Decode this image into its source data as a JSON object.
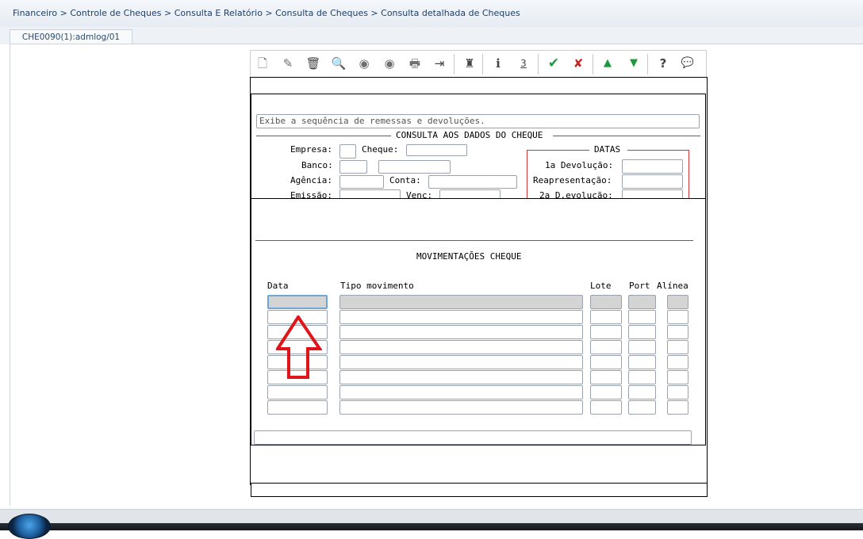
{
  "breadcrumb": {
    "path": "Financeiro > Controle de Cheques > Consulta E Relatório > Consulta de Cheques > Consulta detalhada de Cheques"
  },
  "tab": {
    "label": "CHE0090(1):admlog/01"
  },
  "toolbar": {
    "buttons": [
      {
        "icon": "new-doc-icon",
        "glyph": "🗋"
      },
      {
        "icon": "edit-icon",
        "glyph": "✎"
      },
      {
        "icon": "trash-icon",
        "glyph": "🗑"
      },
      {
        "icon": "magnifier-icon",
        "glyph": "🔍"
      },
      {
        "icon": "prev-circle-icon",
        "glyph": "◉"
      },
      {
        "icon": "next-circle-icon",
        "glyph": "◉"
      },
      {
        "icon": "print-icon",
        "glyph": "🖶"
      },
      {
        "icon": "exit-icon",
        "glyph": "⇥"
      },
      {
        "icon": "binoculars-icon",
        "glyph": "♜"
      },
      {
        "icon": "info-icon",
        "glyph": "i"
      },
      {
        "icon": "number-icon",
        "glyph": "3"
      },
      {
        "icon": "confirm-check-icon",
        "glyph": "✔"
      },
      {
        "icon": "cancel-x-icon",
        "glyph": "✘"
      },
      {
        "icon": "up-triangle-icon",
        "glyph": "▲"
      },
      {
        "icon": "down-triangle-icon",
        "glyph": "▼"
      },
      {
        "icon": "help-icon",
        "glyph": "?"
      },
      {
        "icon": "comment-icon",
        "glyph": "💬"
      }
    ],
    "colors": {
      "check": "#1a9a3a",
      "x": "#cc2222",
      "up": "#1a9a3a",
      "down": "#1a9a3a",
      "default": "#6f6f6f"
    }
  },
  "form": {
    "hint": "Exibe a sequência de remessas e devoluções.",
    "section_title": "CONSULTA AOS DADOS DO CHEQUE",
    "labels": {
      "empresa": "Empresa:",
      "cheque": "Cheque:",
      "banco": "Banco:",
      "agencia": "Agência:",
      "conta": "Conta:",
      "emissao": "Emissão:",
      "venc": "Venc:"
    },
    "datas": {
      "title": "DATAS",
      "devolucao1": "1a Devolução:",
      "reapresentacao": "Reapresentação:",
      "devolucao2": "2a D.evolução:"
    }
  },
  "movimentacoes": {
    "title": "MOVIMENTAÇÕES CHEQUE",
    "columns": [
      "Data",
      "Tipo movimento",
      "Lote",
      "Port",
      "Alínea"
    ],
    "row_count": 8
  },
  "accent_color": "#cc3333",
  "annotation": {
    "arrow_color": "#e0151a",
    "icon": "up-arrow-annotation-icon"
  }
}
